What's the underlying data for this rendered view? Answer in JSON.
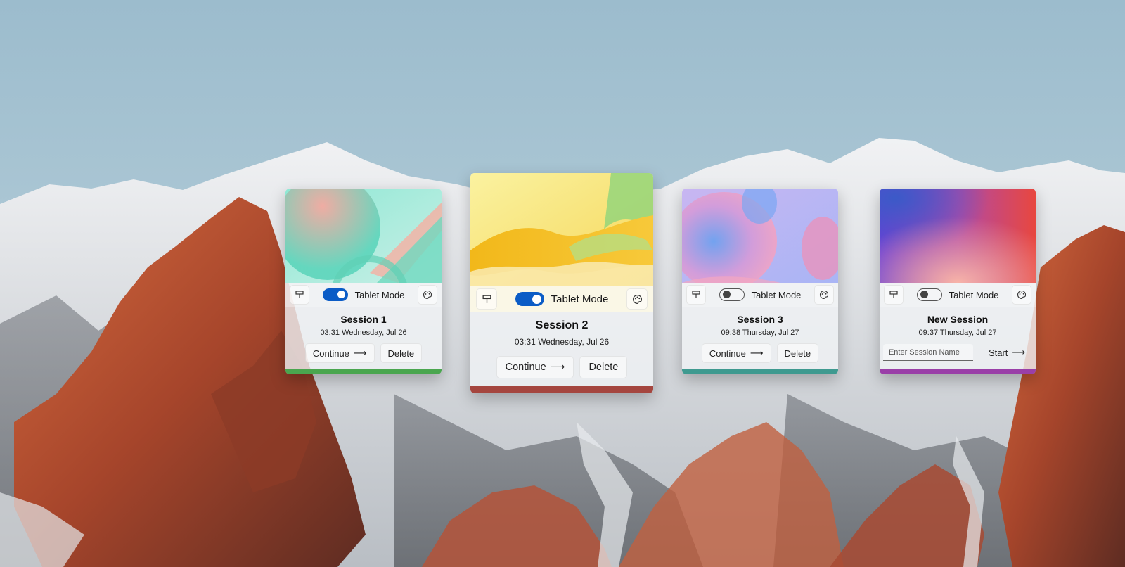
{
  "sessions": [
    {
      "title": "Session 1",
      "timestamp": "03:31 Wednesday, Jul 26",
      "tablet_mode": true,
      "tablet_label": "Tablet Mode",
      "continue_label": "Continue",
      "delete_label": "Delete",
      "accent": "#4aa64f"
    },
    {
      "title": "Session 2",
      "timestamp": "03:31 Wednesday, Jul 26",
      "tablet_mode": true,
      "tablet_label": "Tablet Mode",
      "continue_label": "Continue",
      "delete_label": "Delete",
      "accent": "#a5463f"
    },
    {
      "title": "Session 3",
      "timestamp": "09:38 Thursday, Jul 27",
      "tablet_mode": false,
      "tablet_label": "Tablet Mode",
      "continue_label": "Continue",
      "delete_label": "Delete",
      "accent": "#3f9a90"
    }
  ],
  "new_session": {
    "title": "New Session",
    "timestamp": "09:37 Thursday, Jul 27",
    "tablet_mode": false,
    "tablet_label": "Tablet Mode",
    "name_placeholder": "Enter Session Name",
    "name_value": "",
    "start_label": "Start",
    "accent": "#9a3fa8"
  },
  "icons": {
    "left": "pin-icon",
    "right": "palette-icon",
    "arrow": "arrow-right-icon"
  },
  "arrow_glyph": "⟶"
}
